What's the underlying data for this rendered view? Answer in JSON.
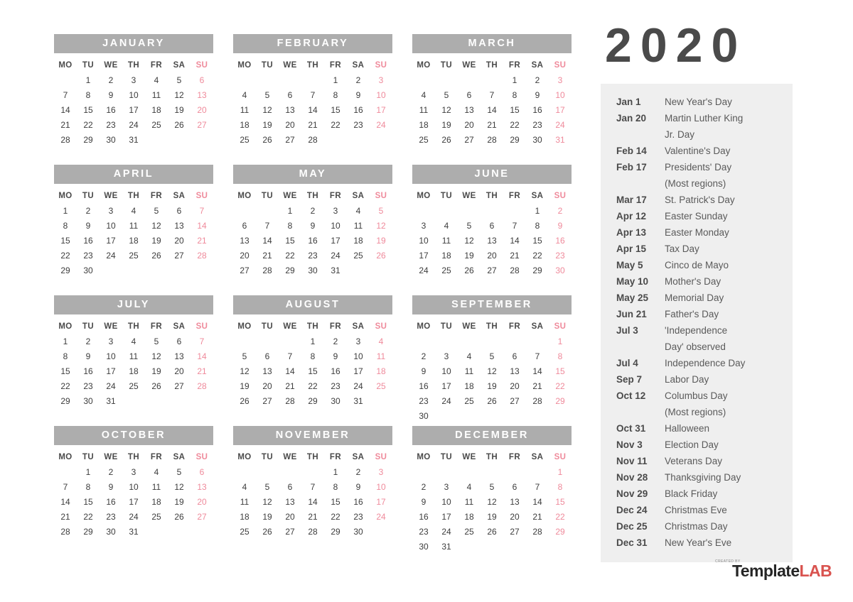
{
  "year": "2020",
  "weekday_headers": [
    "MO",
    "TU",
    "WE",
    "TH",
    "FR",
    "SA",
    "SU"
  ],
  "colors": {
    "month_header_bg": "#adadad",
    "month_header_text": "#ffffff",
    "sunday_text": "#ef8a9b",
    "day_text": "#3d3d3d",
    "holiday_panel_bg": "#efefef",
    "year_text": "#4a4a4a",
    "logo_accent": "#d9534f"
  },
  "months": [
    {
      "name": "JANUARY",
      "weeks": [
        [
          "",
          "1",
          "2",
          "3",
          "4",
          "5",
          "6"
        ],
        [
          "7",
          "8",
          "9",
          "10",
          "11",
          "12",
          "13"
        ],
        [
          "14",
          "15",
          "16",
          "17",
          "18",
          "19",
          "20"
        ],
        [
          "21",
          "22",
          "23",
          "24",
          "25",
          "26",
          "27"
        ],
        [
          "28",
          "29",
          "30",
          "31",
          "",
          "",
          ""
        ]
      ]
    },
    {
      "name": "FEBRUARY",
      "weeks": [
        [
          "",
          "",
          "",
          "",
          "1",
          "2",
          "3"
        ],
        [
          "4",
          "5",
          "6",
          "7",
          "8",
          "9",
          "10"
        ],
        [
          "11",
          "12",
          "13",
          "14",
          "15",
          "16",
          "17"
        ],
        [
          "18",
          "19",
          "20",
          "21",
          "22",
          "23",
          "24"
        ],
        [
          "25",
          "26",
          "27",
          "28",
          "",
          "",
          ""
        ]
      ]
    },
    {
      "name": "MARCH",
      "weeks": [
        [
          "",
          "",
          "",
          "",
          "1",
          "2",
          "3"
        ],
        [
          "4",
          "5",
          "6",
          "7",
          "8",
          "9",
          "10"
        ],
        [
          "11",
          "12",
          "13",
          "14",
          "15",
          "16",
          "17"
        ],
        [
          "18",
          "19",
          "20",
          "21",
          "22",
          "23",
          "24"
        ],
        [
          "25",
          "26",
          "27",
          "28",
          "29",
          "30",
          "31"
        ]
      ]
    },
    {
      "name": "APRIL",
      "weeks": [
        [
          "1",
          "2",
          "3",
          "4",
          "5",
          "6",
          "7"
        ],
        [
          "8",
          "9",
          "10",
          "11",
          "12",
          "13",
          "14"
        ],
        [
          "15",
          "16",
          "17",
          "18",
          "19",
          "20",
          "21"
        ],
        [
          "22",
          "23",
          "24",
          "25",
          "26",
          "27",
          "28"
        ],
        [
          "29",
          "30",
          "",
          "",
          "",
          "",
          ""
        ]
      ]
    },
    {
      "name": "MAY",
      "weeks": [
        [
          "",
          "",
          "1",
          "2",
          "3",
          "4",
          "5"
        ],
        [
          "6",
          "7",
          "8",
          "9",
          "10",
          "11",
          "12"
        ],
        [
          "13",
          "14",
          "15",
          "16",
          "17",
          "18",
          "19"
        ],
        [
          "20",
          "21",
          "22",
          "23",
          "24",
          "25",
          "26"
        ],
        [
          "27",
          "28",
          "29",
          "30",
          "31",
          "",
          ""
        ]
      ]
    },
    {
      "name": "JUNE",
      "weeks": [
        [
          "",
          "",
          "",
          "",
          "",
          "1",
          "2"
        ],
        [
          "3",
          "4",
          "5",
          "6",
          "7",
          "8",
          "9"
        ],
        [
          "10",
          "11",
          "12",
          "13",
          "14",
          "15",
          "16"
        ],
        [
          "17",
          "18",
          "19",
          "20",
          "21",
          "22",
          "23"
        ],
        [
          "24",
          "25",
          "26",
          "27",
          "28",
          "29",
          "30"
        ]
      ]
    },
    {
      "name": "JULY",
      "weeks": [
        [
          "1",
          "2",
          "3",
          "4",
          "5",
          "6",
          "7"
        ],
        [
          "8",
          "9",
          "10",
          "11",
          "12",
          "13",
          "14"
        ],
        [
          "15",
          "16",
          "17",
          "18",
          "19",
          "20",
          "21"
        ],
        [
          "22",
          "23",
          "24",
          "25",
          "26",
          "27",
          "28"
        ],
        [
          "29",
          "30",
          "31",
          "",
          "",
          "",
          ""
        ]
      ]
    },
    {
      "name": "AUGUST",
      "weeks": [
        [
          "",
          "",
          "",
          "1",
          "2",
          "3",
          "4"
        ],
        [
          "5",
          "6",
          "7",
          "8",
          "9",
          "10",
          "11"
        ],
        [
          "12",
          "13",
          "14",
          "15",
          "16",
          "17",
          "18"
        ],
        [
          "19",
          "20",
          "21",
          "22",
          "23",
          "24",
          "25"
        ],
        [
          "26",
          "27",
          "28",
          "29",
          "30",
          "31",
          ""
        ]
      ]
    },
    {
      "name": "SEPTEMBER",
      "weeks": [
        [
          "",
          "",
          "",
          "",
          "",
          "",
          "1"
        ],
        [
          "2",
          "3",
          "4",
          "5",
          "6",
          "7",
          "8"
        ],
        [
          "9",
          "10",
          "11",
          "12",
          "13",
          "14",
          "15"
        ],
        [
          "16",
          "17",
          "18",
          "19",
          "20",
          "21",
          "22"
        ],
        [
          "23",
          "24",
          "25",
          "26",
          "27",
          "28",
          "29"
        ],
        [
          "30",
          "",
          "",
          "",
          "",
          "",
          ""
        ]
      ]
    },
    {
      "name": "OCTOBER",
      "weeks": [
        [
          "",
          "1",
          "2",
          "3",
          "4",
          "5",
          "6"
        ],
        [
          "7",
          "8",
          "9",
          "10",
          "11",
          "12",
          "13"
        ],
        [
          "14",
          "15",
          "16",
          "17",
          "18",
          "19",
          "20"
        ],
        [
          "21",
          "22",
          "23",
          "24",
          "25",
          "26",
          "27"
        ],
        [
          "28",
          "29",
          "30",
          "31",
          "",
          "",
          ""
        ]
      ]
    },
    {
      "name": "NOVEMBER",
      "weeks": [
        [
          "",
          "",
          "",
          "",
          "1",
          "2",
          "3"
        ],
        [
          "4",
          "5",
          "6",
          "7",
          "8",
          "9",
          "10"
        ],
        [
          "11",
          "12",
          "13",
          "14",
          "15",
          "16",
          "17"
        ],
        [
          "18",
          "19",
          "20",
          "21",
          "22",
          "23",
          "24"
        ],
        [
          "25",
          "26",
          "27",
          "28",
          "29",
          "30",
          ""
        ]
      ]
    },
    {
      "name": "DECEMBER",
      "weeks": [
        [
          "",
          "",
          "",
          "",
          "",
          "",
          "1"
        ],
        [
          "2",
          "3",
          "4",
          "5",
          "6",
          "7",
          "8"
        ],
        [
          "9",
          "10",
          "11",
          "12",
          "13",
          "14",
          "15"
        ],
        [
          "16",
          "17",
          "18",
          "19",
          "20",
          "21",
          "22"
        ],
        [
          "23",
          "24",
          "25",
          "26",
          "27",
          "28",
          "29"
        ],
        [
          "30",
          "31",
          "",
          "",
          "",
          "",
          ""
        ]
      ]
    }
  ],
  "holidays": [
    {
      "date": "Jan 1",
      "name": "New Year's Day",
      "cont": ""
    },
    {
      "date": "Jan 20",
      "name": "Martin Luther King",
      "cont": "Jr. Day"
    },
    {
      "date": "Feb 14",
      "name": "Valentine's Day",
      "cont": ""
    },
    {
      "date": "Feb 17",
      "name": "Presidents' Day",
      "cont": "(Most regions)"
    },
    {
      "date": "Mar 17",
      "name": "St. Patrick's Day",
      "cont": ""
    },
    {
      "date": "Apr 12",
      "name": "Easter Sunday",
      "cont": ""
    },
    {
      "date": "Apr 13",
      "name": "Easter Monday",
      "cont": ""
    },
    {
      "date": "Apr 15",
      "name": "Tax Day",
      "cont": ""
    },
    {
      "date": "May 5",
      "name": "Cinco de Mayo",
      "cont": ""
    },
    {
      "date": "May 10",
      "name": "Mother's Day",
      "cont": ""
    },
    {
      "date": "May 25",
      "name": "Memorial Day",
      "cont": ""
    },
    {
      "date": "Jun 21",
      "name": "Father's Day",
      "cont": ""
    },
    {
      "date": "Jul 3",
      "name": "'Independence",
      "cont": "Day' observed"
    },
    {
      "date": "Jul 4",
      "name": "Independence Day",
      "cont": ""
    },
    {
      "date": "Sep 7",
      "name": "Labor Day",
      "cont": ""
    },
    {
      "date": "Oct 12",
      "name": "Columbus Day",
      "cont": "(Most regions)"
    },
    {
      "date": "Oct 31",
      "name": "Halloween",
      "cont": ""
    },
    {
      "date": "Nov 3",
      "name": "Election Day",
      "cont": ""
    },
    {
      "date": "Nov 11",
      "name": "Veterans Day",
      "cont": ""
    },
    {
      "date": "Nov 28",
      "name": "Thanksgiving Day",
      "cont": ""
    },
    {
      "date": "Nov 29",
      "name": "Black Friday",
      "cont": ""
    },
    {
      "date": "Dec 24",
      "name": "Christmas Eve",
      "cont": ""
    },
    {
      "date": "Dec 25",
      "name": "Christmas Day",
      "cont": ""
    },
    {
      "date": "Dec 31",
      "name": "New Year's Eve",
      "cont": ""
    }
  ],
  "logo": {
    "tagline": "CREATED BY",
    "part1": "Template",
    "part2": "LAB"
  }
}
